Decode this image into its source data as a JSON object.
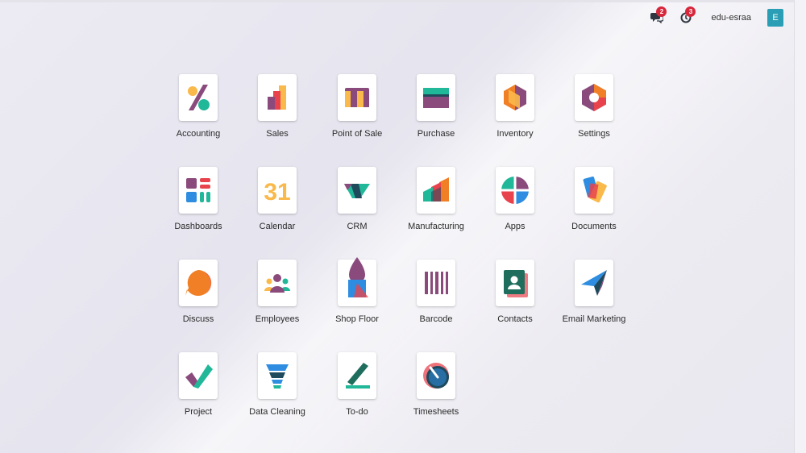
{
  "topbar": {
    "messages_badge": "2",
    "activities_badge": "3",
    "user_name": "edu-esraa",
    "avatar_letter": "E"
  },
  "apps": [
    {
      "label": "Accounting",
      "icon": "accounting-icon"
    },
    {
      "label": "Sales",
      "icon": "sales-icon"
    },
    {
      "label": "Point of Sale",
      "icon": "point-of-sale-icon"
    },
    {
      "label": "Purchase",
      "icon": "purchase-icon"
    },
    {
      "label": "Inventory",
      "icon": "inventory-icon"
    },
    {
      "label": "Settings",
      "icon": "settings-icon"
    },
    {
      "label": "Dashboards",
      "icon": "dashboards-icon"
    },
    {
      "label": "Calendar",
      "icon": "calendar-icon"
    },
    {
      "label": "CRM",
      "icon": "crm-icon"
    },
    {
      "label": "Manufacturing",
      "icon": "manufacturing-icon"
    },
    {
      "label": "Apps",
      "icon": "apps-icon"
    },
    {
      "label": "Documents",
      "icon": "documents-icon"
    },
    {
      "label": "Discuss",
      "icon": "discuss-icon"
    },
    {
      "label": "Employees",
      "icon": "employees-icon"
    },
    {
      "label": "Shop Floor",
      "icon": "shop-floor-icon"
    },
    {
      "label": "Barcode",
      "icon": "barcode-icon"
    },
    {
      "label": "Contacts",
      "icon": "contacts-icon"
    },
    {
      "label": "Email Marketing",
      "icon": "email-marketing-icon"
    },
    {
      "label": "Project",
      "icon": "project-icon"
    },
    {
      "label": "Data Cleaning",
      "icon": "data-cleaning-icon"
    },
    {
      "label": "To-do",
      "icon": "todo-icon"
    },
    {
      "label": "Timesheets",
      "icon": "timesheets-icon"
    }
  ],
  "calendar_icon_text": "31",
  "colors": {
    "purple": "#8a4b7c",
    "teal": "#21b799",
    "orange": "#f07f26",
    "yellow": "#f9b94b",
    "blue": "#2e8de0",
    "red": "#e8434d",
    "badge": "#d6273b",
    "avatar": "#2a9eb5"
  }
}
